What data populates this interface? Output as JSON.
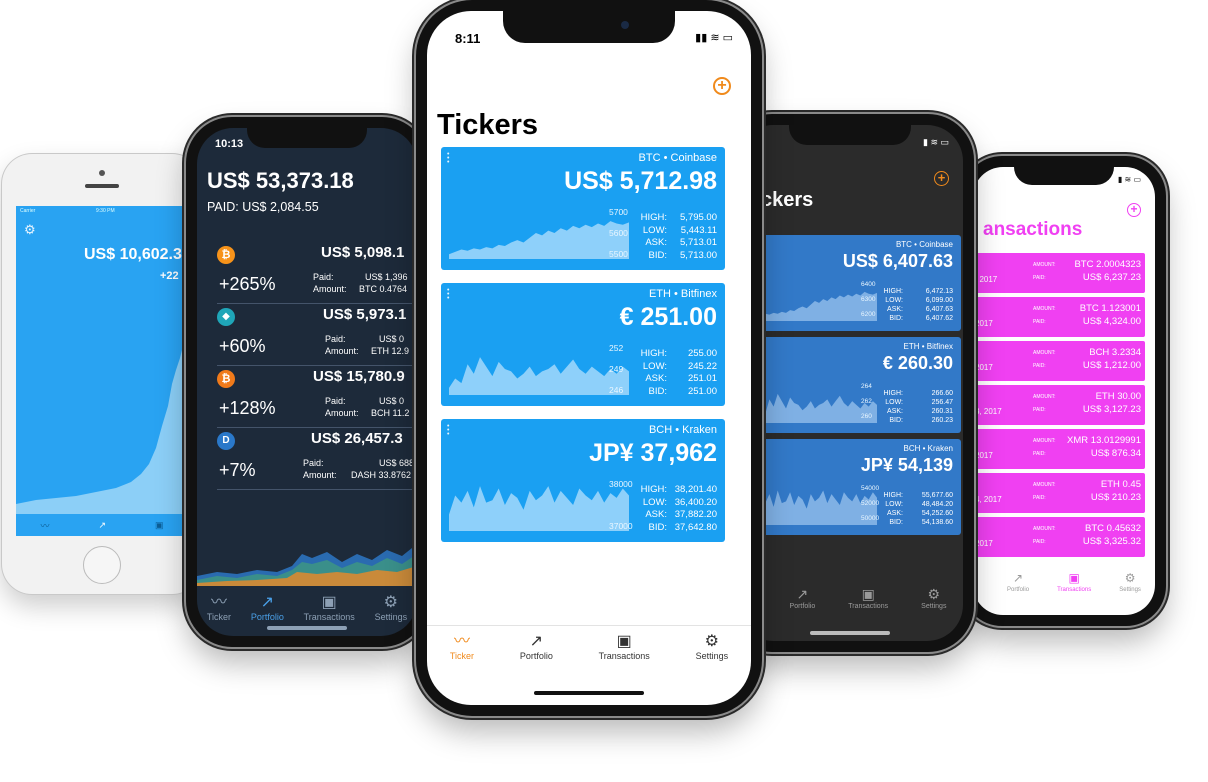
{
  "colors": {
    "ticker_blue": "#1aa0f2",
    "accent_orange": "#f08a1c",
    "portfolio_bg": "#1d2a3a",
    "dark_bg": "#2b2b2b",
    "dark_card": "#3279c8",
    "magenta": "#f040f2"
  },
  "tabs": {
    "ticker": "Ticker",
    "portfolio": "Portfolio",
    "transactions": "Transactions",
    "settings": "Settings"
  },
  "old_phone": {
    "carrier": "Carrier",
    "time": "9:30 PM",
    "total": "US$ 10,602.3",
    "change": "+22"
  },
  "portfolio_phone": {
    "time": "10:13",
    "total": "US$ 53,373.18",
    "paid": "PAID: US$ 2,084.55",
    "paid_label": "Paid:",
    "amount_label": "Amount:",
    "items": [
      {
        "icon": "bitcoin-icon",
        "glyph": "₿",
        "color": "#f7931a",
        "value": "US$ 5,098.1",
        "pct": "+265%",
        "paid": "US$ 1,396",
        "amount": "BTC 0.4764"
      },
      {
        "icon": "ethereum-icon",
        "glyph": "◆",
        "color": "#1fa6b8",
        "value": "US$ 5,973.1",
        "pct": "+60%",
        "paid": "US$ 0",
        "amount": "ETH 12.9"
      },
      {
        "icon": "bitcoin-cash-icon",
        "glyph": "₿",
        "color": "#f07a1a",
        "value": "US$ 15,780.9",
        "pct": "+128%",
        "paid": "US$ 0",
        "amount": "BCH 11.2"
      },
      {
        "icon": "dash-icon",
        "glyph": "D",
        "color": "#2a78c9",
        "value": "US$ 26,457.3",
        "pct": "+7%",
        "paid": "US$ 688",
        "amount": "DASH 33.8762"
      }
    ]
  },
  "center_phone": {
    "time": "8:11",
    "title": "Tickers",
    "cards": [
      {
        "source": "BTC • Coinbase",
        "price": "US$ 5,712.98",
        "axis": [
          "5700",
          "5600",
          "5500"
        ],
        "labels": [
          "HIGH:",
          "LOW:",
          "ASK:",
          "BID:"
        ],
        "values": [
          "5,795.00",
          "5,443.11",
          "5,713.01",
          "5,713.00"
        ]
      },
      {
        "source": "ETH • Bitfinex",
        "price": "€ 251.00",
        "axis": [
          "252",
          "249",
          "246"
        ],
        "labels": [
          "HIGH:",
          "LOW:",
          "ASK:",
          "BID:"
        ],
        "values": [
          "255.00",
          "245.22",
          "251.01",
          "251.00"
        ]
      },
      {
        "source": "BCH • Kraken",
        "price": "JP¥ 37,962",
        "axis": [
          "38000",
          "37000"
        ],
        "labels": [
          "HIGH:",
          "LOW:",
          "ASK:",
          "BID:"
        ],
        "values": [
          "38,201.40",
          "36,400.20",
          "37,882.20",
          "37,642.80"
        ]
      }
    ]
  },
  "dark_phone": {
    "time": "4",
    "title": "ckers",
    "cards": [
      {
        "source": "BTC • Coinbase",
        "price": "US$ 6,407.63",
        "axis": [
          "6400",
          "6300",
          "6200"
        ],
        "labels": [
          "HIGH:",
          "LOW:",
          "ASK:",
          "BID:"
        ],
        "values": [
          "6,472.13",
          "6,099.00",
          "6,407.63",
          "6,407.62"
        ]
      },
      {
        "source": "ETH • Bitfinex",
        "price": "€ 260.30",
        "axis": [
          "264",
          "262",
          "260"
        ],
        "labels": [
          "HIGH:",
          "LOW:",
          "ASK:",
          "BID:"
        ],
        "values": [
          "266.60",
          "256.47",
          "260.31",
          "260.23"
        ]
      },
      {
        "source": "BCH • Kraken",
        "price": "JP¥ 54,139",
        "axis": [
          "54000",
          "52000",
          "50000"
        ],
        "labels": [
          "HIGH:",
          "LOW:",
          "ASK:",
          "BID:"
        ],
        "values": [
          "55,677.60",
          "48,484.20",
          "54,252.60",
          "54,138.60"
        ]
      }
    ]
  },
  "magenta_phone": {
    "title": "ansactions",
    "amount_label": "AMOUNT:",
    "paid_label": "PAID:",
    "rows": [
      {
        "date": ", 2017",
        "amount": "BTC 2.0004323",
        "paid": "US$ 6,237.23"
      },
      {
        "date": "2017",
        "amount": "BTC 1.123001",
        "paid": "US$ 4,324.00"
      },
      {
        "date": "2017",
        "amount": "BCH 3.2334",
        "paid": "US$ 1,212.00"
      },
      {
        "date": "3, 2017",
        "amount": "ETH 30.00",
        "paid": "US$ 3,127.23"
      },
      {
        "date": "2017",
        "amount": "XMR 13.0129991",
        "paid": "US$ 876.34"
      },
      {
        "date": "4, 2017",
        "amount": "ETH 0.45",
        "paid": "US$ 210.23"
      },
      {
        "date": "2017",
        "amount": "BTC 0.45632",
        "paid": "US$ 3,325.32"
      }
    ]
  }
}
